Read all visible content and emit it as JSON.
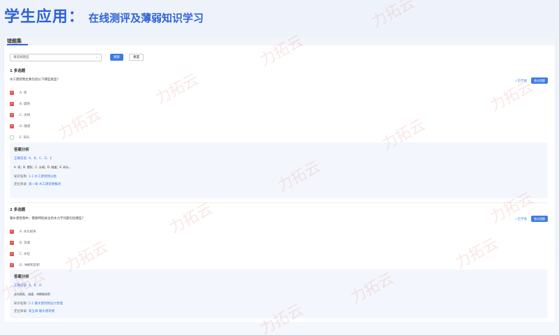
{
  "header": {
    "main_title": "学生应用：",
    "sub_title": "在线测评及薄弱知识学习"
  },
  "panel": {
    "title": "错题集"
  },
  "filter": {
    "select_value": "请选择题型",
    "search_label": "搜索",
    "reset_label": "重置"
  },
  "questions": [
    {
      "heading": "1 多选题",
      "text": "水工建筑物主要包括以下哪些类型?",
      "learned_label": "✓已学会",
      "wrongbook_label": "移出错题",
      "options": [
        {
          "label": "A. 坝",
          "checked": true
        },
        {
          "label": "B. 堤防",
          "checked": true
        },
        {
          "label": "C. 水闸",
          "checked": true
        },
        {
          "label": "D. 隧道",
          "checked": true
        },
        {
          "label": "E. 码头",
          "checked": false
        }
      ],
      "analysis": {
        "title": "答案分析",
        "answer_prefix": "正确答案:",
        "answer_value": "A、B、C、D、E",
        "detail": "A. 坝；B. 堤防；C. 水闸；D. 隧道；E. 码头。",
        "kp_prefix": "知识名称:",
        "kp_value": "1.2 水工建筑物分类",
        "loc_prefix": "定位目录:",
        "loc_value": "第一章 水工建筑物概述"
      }
    },
    {
      "heading": "2 多选题",
      "text": "输水建筑物中，需要特别关注的水力学问题包括哪些?",
      "learned_label": "✓已学会",
      "wrongbook_label": "移出错题",
      "options": [
        {
          "label": "A. 水头损失",
          "checked": true
        },
        {
          "label": "B. 流速",
          "checked": true
        },
        {
          "label": "C. 水位",
          "checked": true
        },
        {
          "label": "D. 冲刷和淤积",
          "checked": true
        }
      ],
      "analysis": {
        "title": "答案分析",
        "answer_prefix": "正确答案:",
        "answer_value": "A、B、D",
        "detail": "水头损失、流速、冲刷和淤积",
        "kp_prefix": "知识名称:",
        "kp_value": "5.1 输水建筑物设计原理",
        "loc_prefix": "定位目录:",
        "loc_value": "第五章 输水建筑物"
      }
    }
  ],
  "watermark_text": "力拓云",
  "colors": {
    "accent": "#2f62d8",
    "primary_button": "#3d7be6",
    "checked": "#e0554d"
  }
}
